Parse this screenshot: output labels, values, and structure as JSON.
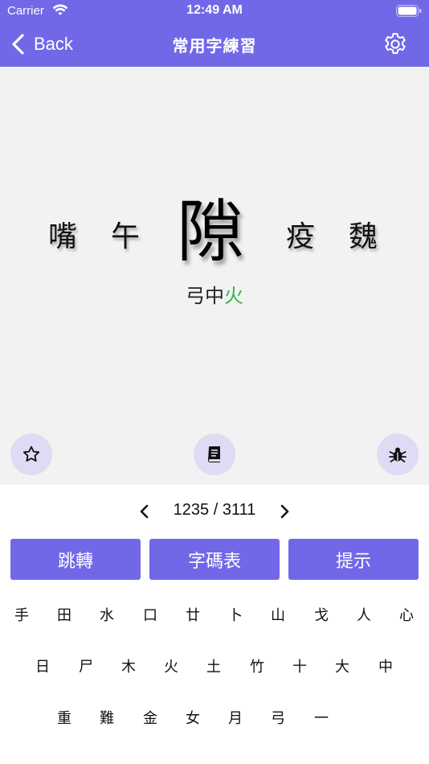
{
  "status_bar": {
    "carrier": "Carrier",
    "time": "12:49 AM"
  },
  "nav": {
    "back_label": "Back",
    "title": "常用字練習"
  },
  "practice": {
    "prev_chars": [
      "嘴",
      "午"
    ],
    "current_char": "隙",
    "next_chars": [
      "疫",
      "魏"
    ],
    "code_radicals": [
      "弓",
      "中",
      "火"
    ]
  },
  "pager": {
    "count": "1235 / 3111"
  },
  "actions": {
    "jump": "跳轉",
    "code_table": "字碼表",
    "hint": "提示"
  },
  "keyboard": {
    "row1": [
      "手",
      "田",
      "水",
      "口",
      "廿",
      "卜",
      "山",
      "戈",
      "人",
      "心"
    ],
    "row2": [
      "日",
      "尸",
      "木",
      "火",
      "土",
      "竹",
      "十",
      "大",
      "中"
    ],
    "row3": [
      "重",
      "難",
      "金",
      "女",
      "月",
      "弓",
      "一"
    ]
  },
  "colors": {
    "accent": "#7168e8",
    "highlight": "#38b54a",
    "practice_bg": "#f2f2f3",
    "circle_bg": "#dedcf4"
  },
  "icons": {
    "gear": "gear-icon",
    "back": "chevron-left-icon",
    "star": "star-icon",
    "book": "book-icon",
    "bug": "bug-icon",
    "prev": "chevron-left-icon",
    "next": "chevron-right-icon"
  }
}
